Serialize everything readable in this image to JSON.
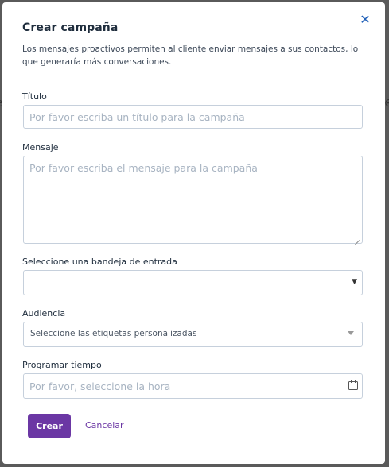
{
  "modal": {
    "title": "Crear campaña",
    "description": "Los mensajes proactivos permiten al cliente enviar mensajes a sus contactos, lo que generaría más conversaciones.",
    "close_icon": "close-icon"
  },
  "form": {
    "title_label": "Título",
    "title_placeholder": "Por favor escriba un título para la campaña",
    "title_value": "",
    "message_label": "Mensaje",
    "message_placeholder": "Por favor escriba el mensaje para la campaña",
    "message_value": "",
    "inbox_label": "Seleccione una bandeja de entrada",
    "inbox_value": "",
    "audience_label": "Audiencia",
    "audience_placeholder": "Seleccione las etiquetas personalizadas",
    "schedule_label": "Programar tiempo",
    "schedule_placeholder": "Por favor, seleccione la hora",
    "schedule_value": ""
  },
  "actions": {
    "create_label": "Crear",
    "cancel_label": "Cancelar"
  },
  "colors": {
    "accent": "#6b37a4",
    "close": "#1f5fb8",
    "border": "#c6d0dc",
    "placeholder": "#a8b4c2"
  }
}
